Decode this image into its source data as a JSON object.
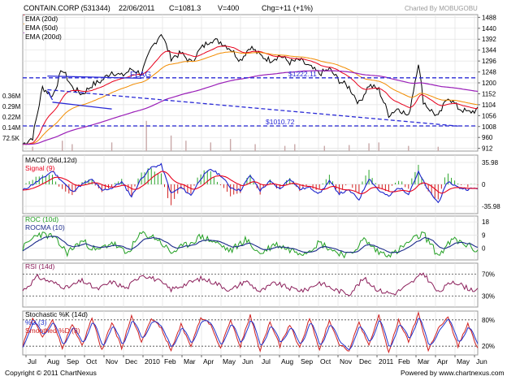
{
  "header": {
    "symbol": "CONTAIN.CORP (531344)",
    "date": "22/06/2011",
    "close": "C=1081.3",
    "volume": "V=400",
    "change": "Chg=+11 (+1%)",
    "credit": "Charted By MOBUGOBU"
  },
  "footer": {
    "copyright": "Copyright © 2011 ChartNexus",
    "powered": "Powered by www.chartnexus.com"
  },
  "x_axis": {
    "labels": [
      "Jul",
      "Aug",
      "Sep",
      "Oct",
      "Nov",
      "Dec",
      "2010",
      "Feb",
      "Mar",
      "Apr",
      "May",
      "Jun",
      "Jul",
      "Aug",
      "Sep",
      "Oct",
      "Nov",
      "Dec",
      "2011",
      "Feb",
      "Mar",
      "Apr",
      "May",
      "Jun"
    ]
  },
  "colors": {
    "price": "#000000",
    "ema20": "#e8001c",
    "ema50": "#f28c00",
    "ema200": "#9a1fb8",
    "volume": "#c9a9a9",
    "annotation": "#2a2ad6",
    "macd": "#1a22cc",
    "signal": "#e8001c",
    "histogram_pos": "#2ea62e",
    "histogram_neg": "#d02020",
    "roc": "#22a022",
    "rocma": "#1a2a8a",
    "rsi": "#8b1e5a",
    "stoch_k": "#d02020",
    "stoch_d": "#2233cc",
    "stoch_smoothed": "#d02020"
  },
  "chart_data": [
    {
      "type": "line",
      "panel": "price",
      "series": [
        {
          "name": "EMA (20d)"
        },
        {
          "name": "EMA (50d)"
        },
        {
          "name": "EMA (200d)"
        }
      ],
      "close_points": [
        [
          0,
          930
        ],
        [
          2,
          960
        ],
        [
          4,
          1180
        ],
        [
          6,
          1140
        ],
        [
          8,
          1260
        ],
        [
          10,
          1180
        ],
        [
          12,
          1150
        ],
        [
          14,
          1190
        ],
        [
          16,
          1210
        ],
        [
          18,
          1250
        ],
        [
          20,
          1230
        ],
        [
          22,
          1260
        ],
        [
          24,
          1240
        ],
        [
          26,
          1350
        ],
        [
          28,
          1420
        ],
        [
          30,
          1310
        ],
        [
          32,
          1330
        ],
        [
          34,
          1290
        ],
        [
          36,
          1350
        ],
        [
          38,
          1390
        ],
        [
          40,
          1380
        ],
        [
          42,
          1350
        ],
        [
          44,
          1300
        ],
        [
          46,
          1360
        ],
        [
          48,
          1320
        ],
        [
          50,
          1300
        ],
        [
          52,
          1320
        ],
        [
          54,
          1290
        ],
        [
          56,
          1300
        ],
        [
          58,
          1270
        ],
        [
          60,
          1240
        ],
        [
          62,
          1260
        ],
        [
          64,
          1210
        ],
        [
          66,
          1180
        ],
        [
          68,
          1110
        ],
        [
          70,
          1190
        ],
        [
          72,
          1170
        ],
        [
          74,
          1060
        ],
        [
          76,
          1090
        ],
        [
          78,
          1050
        ],
        [
          80,
          1290
        ],
        [
          81,
          1120
        ],
        [
          82,
          1090
        ],
        [
          84,
          1050
        ],
        [
          86,
          1140
        ],
        [
          88,
          1090
        ],
        [
          90,
          1070
        ],
        [
          92,
          1080
        ]
      ],
      "ylim": [
        900,
        1500
      ],
      "yticks": [
        1488,
        1440,
        1392,
        1344,
        1296,
        1248,
        1200,
        1152,
        1104,
        1056,
        1008,
        960,
        912
      ],
      "volume_labels": [
        "0.36M",
        "0.29M",
        "0.22M",
        "0.14M",
        "72.5K"
      ],
      "volume_bars": [
        [
          2,
          0.05
        ],
        [
          8,
          0.12
        ],
        [
          10,
          0.08
        ],
        [
          18,
          0.1
        ],
        [
          25,
          0.35
        ],
        [
          30,
          0.18
        ],
        [
          33,
          0.12
        ],
        [
          38,
          0.1
        ],
        [
          42,
          0.14
        ],
        [
          47,
          0.08
        ],
        [
          53,
          0.06
        ],
        [
          55,
          0.08
        ],
        [
          61,
          0.06
        ],
        [
          66,
          0.07
        ],
        [
          70,
          0.09
        ],
        [
          72,
          0.1
        ],
        [
          78,
          0.06
        ],
        [
          84,
          0.05
        ]
      ],
      "levels": [
        {
          "label": "$1222.11",
          "value": 1222.11
        },
        {
          "label": "$1010.72",
          "value": 1010.72
        }
      ],
      "annotation": "FLAG",
      "trendlines": [
        {
          "from": [
            5,
            1230
          ],
          "to": [
            24,
            1220
          ]
        },
        {
          "from": [
            5,
            1170
          ],
          "to": [
            88,
            1010
          ]
        },
        {
          "from": [
            6,
            1115
          ],
          "to": [
            18,
            1085
          ]
        },
        {
          "from": [
            5,
            1165
          ],
          "to": [
            6,
            1125
          ]
        }
      ]
    },
    {
      "type": "line",
      "panel": "macd",
      "series": [
        {
          "name": "MACD (26d,12d)"
        },
        {
          "name": "Signal (9)"
        }
      ],
      "yticks": [
        35.98,
        0,
        -35.98
      ],
      "ylim": [
        -48,
        48
      ],
      "macd_points": [
        [
          0,
          -10
        ],
        [
          4,
          10
        ],
        [
          6,
          22
        ],
        [
          8,
          5
        ],
        [
          10,
          -12
        ],
        [
          12,
          0
        ],
        [
          14,
          8
        ],
        [
          16,
          -10
        ],
        [
          18,
          -6
        ],
        [
          20,
          4
        ],
        [
          22,
          -20
        ],
        [
          24,
          10
        ],
        [
          26,
          28
        ],
        [
          28,
          32
        ],
        [
          30,
          -15
        ],
        [
          32,
          -5
        ],
        [
          34,
          -18
        ],
        [
          36,
          10
        ],
        [
          38,
          25
        ],
        [
          40,
          15
        ],
        [
          42,
          -5
        ],
        [
          44,
          -10
        ],
        [
          46,
          15
        ],
        [
          48,
          -10
        ],
        [
          50,
          5
        ],
        [
          52,
          -8
        ],
        [
          54,
          10
        ],
        [
          56,
          -8
        ],
        [
          58,
          -5
        ],
        [
          60,
          -15
        ],
        [
          62,
          5
        ],
        [
          64,
          -15
        ],
        [
          66,
          -10
        ],
        [
          68,
          -25
        ],
        [
          70,
          10
        ],
        [
          72,
          -10
        ],
        [
          74,
          -20
        ],
        [
          76,
          -5
        ],
        [
          78,
          -15
        ],
        [
          80,
          20
        ],
        [
          82,
          -10
        ],
        [
          84,
          -30
        ],
        [
          86,
          5
        ],
        [
          88,
          -5
        ],
        [
          90,
          -8
        ],
        [
          92,
          -6
        ]
      ]
    },
    {
      "type": "line",
      "panel": "roc",
      "series": [
        {
          "name": "ROC (10d)"
        },
        {
          "name": "ROCMA (10)"
        }
      ],
      "yticks": [
        18,
        9,
        0
      ],
      "ylim": [
        -8,
        22
      ],
      "roc_points": [
        [
          0,
          0
        ],
        [
          3,
          10
        ],
        [
          6,
          8
        ],
        [
          9,
          -3
        ],
        [
          12,
          5
        ],
        [
          15,
          -2
        ],
        [
          18,
          4
        ],
        [
          21,
          -4
        ],
        [
          24,
          10
        ],
        [
          27,
          7
        ],
        [
          30,
          -3
        ],
        [
          33,
          2
        ],
        [
          36,
          8
        ],
        [
          39,
          4
        ],
        [
          42,
          -2
        ],
        [
          45,
          6
        ],
        [
          48,
          -4
        ],
        [
          51,
          3
        ],
        [
          54,
          -1
        ],
        [
          57,
          -3
        ],
        [
          60,
          4
        ],
        [
          63,
          -2
        ],
        [
          66,
          -5
        ],
        [
          69,
          6
        ],
        [
          72,
          -3
        ],
        [
          75,
          -4
        ],
        [
          78,
          4
        ],
        [
          81,
          10
        ],
        [
          84,
          -5
        ],
        [
          87,
          6
        ],
        [
          90,
          2
        ],
        [
          92,
          -2
        ]
      ]
    },
    {
      "type": "line",
      "panel": "rsi",
      "series": [
        {
          "name": "RSI (14d)"
        }
      ],
      "yticks": [
        70,
        30
      ],
      "ylim": [
        10,
        90
      ],
      "rsi_points": [
        [
          0,
          40
        ],
        [
          3,
          65
        ],
        [
          6,
          55
        ],
        [
          9,
          45
        ],
        [
          12,
          58
        ],
        [
          15,
          42
        ],
        [
          18,
          56
        ],
        [
          21,
          44
        ],
        [
          24,
          70
        ],
        [
          27,
          60
        ],
        [
          30,
          42
        ],
        [
          33,
          52
        ],
        [
          36,
          62
        ],
        [
          39,
          54
        ],
        [
          42,
          40
        ],
        [
          45,
          58
        ],
        [
          48,
          38
        ],
        [
          51,
          54
        ],
        [
          54,
          44
        ],
        [
          57,
          40
        ],
        [
          60,
          55
        ],
        [
          63,
          42
        ],
        [
          66,
          34
        ],
        [
          69,
          62
        ],
        [
          72,
          40
        ],
        [
          75,
          34
        ],
        [
          78,
          50
        ],
        [
          81,
          72
        ],
        [
          84,
          36
        ],
        [
          87,
          58
        ],
        [
          90,
          44
        ],
        [
          92,
          40
        ]
      ]
    },
    {
      "type": "line",
      "panel": "stochastic",
      "series": [
        {
          "name": "Stochastic %K (14d)"
        },
        {
          "name": "%D (3)"
        },
        {
          "name": "Smoothed %D (3)"
        }
      ],
      "yticks": [
        80,
        20
      ],
      "ylim": [
        0,
        100
      ],
      "stoch_points": [
        [
          0,
          20
        ],
        [
          2,
          85
        ],
        [
          4,
          40
        ],
        [
          6,
          80
        ],
        [
          8,
          15
        ],
        [
          10,
          70
        ],
        [
          12,
          20
        ],
        [
          14,
          85
        ],
        [
          16,
          10
        ],
        [
          18,
          75
        ],
        [
          20,
          15
        ],
        [
          22,
          90
        ],
        [
          24,
          30
        ],
        [
          26,
          85
        ],
        [
          28,
          60
        ],
        [
          30,
          10
        ],
        [
          32,
          70
        ],
        [
          34,
          20
        ],
        [
          36,
          85
        ],
        [
          38,
          70
        ],
        [
          40,
          15
        ],
        [
          42,
          80
        ],
        [
          44,
          20
        ],
        [
          46,
          90
        ],
        [
          48,
          10
        ],
        [
          50,
          75
        ],
        [
          52,
          20
        ],
        [
          54,
          70
        ],
        [
          56,
          15
        ],
        [
          58,
          85
        ],
        [
          60,
          10
        ],
        [
          62,
          80
        ],
        [
          64,
          25
        ],
        [
          66,
          10
        ],
        [
          68,
          75
        ],
        [
          70,
          20
        ],
        [
          72,
          90
        ],
        [
          74,
          5
        ],
        [
          76,
          80
        ],
        [
          78,
          30
        ],
        [
          80,
          95
        ],
        [
          82,
          10
        ],
        [
          84,
          60
        ],
        [
          86,
          85
        ],
        [
          88,
          20
        ],
        [
          90,
          70
        ],
        [
          92,
          15
        ]
      ]
    }
  ]
}
